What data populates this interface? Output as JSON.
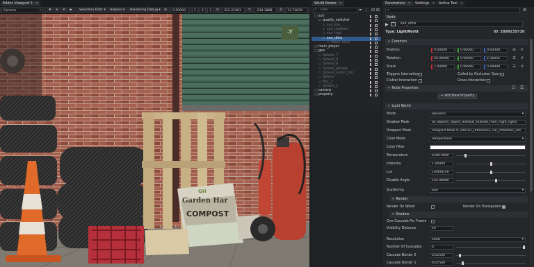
{
  "viewport_panel": {
    "tab_label": "Editor Viewport 1",
    "camera_label": "Camera",
    "selection_filter": "Selection Filter",
    "helpers": "Helpers",
    "rendering_debug": "Rendering Debug",
    "value1": "0.50000",
    "btn1": "1",
    "btn2": "2",
    "btn3": "3",
    "x_label": "X:",
    "x_value": "322.21001",
    "y_label": "Y:",
    "y_value": "-234.3888",
    "z_label": "Z:",
    "z_value": "11.73839",
    "gizmo_axis": "-Y",
    "scene_texts": {
      "bag_line1": "Garden Har",
      "bag_line2": "COMPOST",
      "bag_top": "GH"
    }
  },
  "world_nodes": {
    "tab_label": "World Nodes",
    "filter_placeholder": "Filter",
    "items": [
      {
        "label": "sun",
        "depth": 0,
        "state": "normal"
      },
      {
        "label": "quality_switcher",
        "depth": 1,
        "state": "normal"
      },
      {
        "label": "sun_low",
        "depth": 2,
        "state": "dim"
      },
      {
        "label": "sun_medium",
        "depth": 2,
        "state": "dim"
      },
      {
        "label": "sun_high",
        "depth": 2,
        "state": "dim"
      },
      {
        "label": "sun_ultra",
        "depth": 2,
        "state": "selected"
      },
      {
        "label": "moon_ultra",
        "depth": 3,
        "state": "dim"
      },
      {
        "label": "main_player",
        "depth": 0,
        "state": "normal"
      },
      {
        "label": "geo",
        "depth": 0,
        "state": "normal"
      },
      {
        "label": "Sphere_7",
        "depth": 1,
        "state": "dim"
      },
      {
        "label": "Sphere_8",
        "depth": 1,
        "state": "dim"
      },
      {
        "label": "Sphere_9",
        "depth": 1,
        "state": "dim"
      },
      {
        "label": "Sphere_garage",
        "depth": 1,
        "state": "dim"
      },
      {
        "label": "Sphere_under_bric",
        "depth": 1,
        "state": "dim"
      },
      {
        "label": "Sphere",
        "depth": 1,
        "state": "dim"
      },
      {
        "label": "Box_2",
        "depth": 1,
        "state": "dim"
      },
      {
        "label": "Sphere_1",
        "depth": 1,
        "state": "dim"
      },
      {
        "label": "camera",
        "depth": 0,
        "state": "normal"
      },
      {
        "label": "property",
        "depth": 0,
        "state": "normal"
      }
    ]
  },
  "params": {
    "tabs": [
      "Parameters",
      "Settings",
      "Active Tool"
    ],
    "search_placeholder": "",
    "node_header": "Node",
    "node_name": "sun_ultra",
    "type_label": "Type:",
    "type_value": "LightWorld",
    "id_label": "ID:",
    "id_value": "2089235710",
    "common_section": "Common",
    "position_label": "Position",
    "position": [
      "0.00000",
      "0.00000",
      "0.00000"
    ],
    "rotation_label": "Rotation",
    "rotation": [
      "45.00000",
      "0.00000",
      "2.30035"
    ],
    "scale_label": "Scale",
    "scale": [
      "1.00000",
      "0.99999",
      "0.99999"
    ],
    "triggers_interaction": "Triggers Interaction",
    "culled_by_occlusion": "Culled by Occlusion Query",
    "clutter_interaction": "Clutter Interaction",
    "grass_interaction": "Grass Interaction",
    "node_properties_section": "Node Properties",
    "add_property": "Add New Property",
    "light_world_section": "Light World",
    "mode_label": "Mode",
    "mode_value": "Dynamic",
    "shadow_mask_label": "Shadow Mask",
    "shadow_mask_value": "all_objects, object_without_shadow_from_night_lights",
    "viewport_mask_label": "Viewport Mask",
    "viewport_mask_value": "Viewport Mask 0, interior_reflections, car_reflection_sim",
    "color_mode_label": "Color Mode",
    "color_mode_value": "Temperature",
    "color_filter_label": "Color Filter",
    "color_filter_value": "#ffffff",
    "temperature_label": "Temperature",
    "temperature_value": "6300.0000",
    "temperature_level": 0.12,
    "intensity_label": "Intensity",
    "intensity_value": "1.00000",
    "intensity_level": 0.5,
    "lux_label": "Lux",
    "lux_value": "100000.00",
    "lux_level": 0.5,
    "disable_angle_label": "Disable Angle",
    "disable_angle_value": "105.00000",
    "disable_angle_level": 0.58,
    "scattering_label": "Scattering",
    "scattering_value": "Sun",
    "render_section": "Render",
    "render_on_water": "Render On Water",
    "render_on_transparent": "Render On Transparent",
    "shadow_section": "Shadow",
    "one_cascade_label": "One Cascade Per Frame",
    "visibility_distance_label": "Visibility Distance",
    "visibility_distance_value": "inf",
    "resolution_label": "Resolution",
    "resolution_value": "2048",
    "num_cascades_label": "Number Of Cascades",
    "num_cascades_value": "4",
    "cascade0_label": "Cascade Border 0",
    "cascade0_value": "0.02500",
    "cascade1_label": "Cascade Border 1",
    "cascade1_value": "0.07500"
  },
  "colors": {
    "accent": "#3d6fae",
    "selected_row": "#2f5b8c",
    "brick": "#8a4a3c",
    "garage": "#3c5a4a"
  }
}
